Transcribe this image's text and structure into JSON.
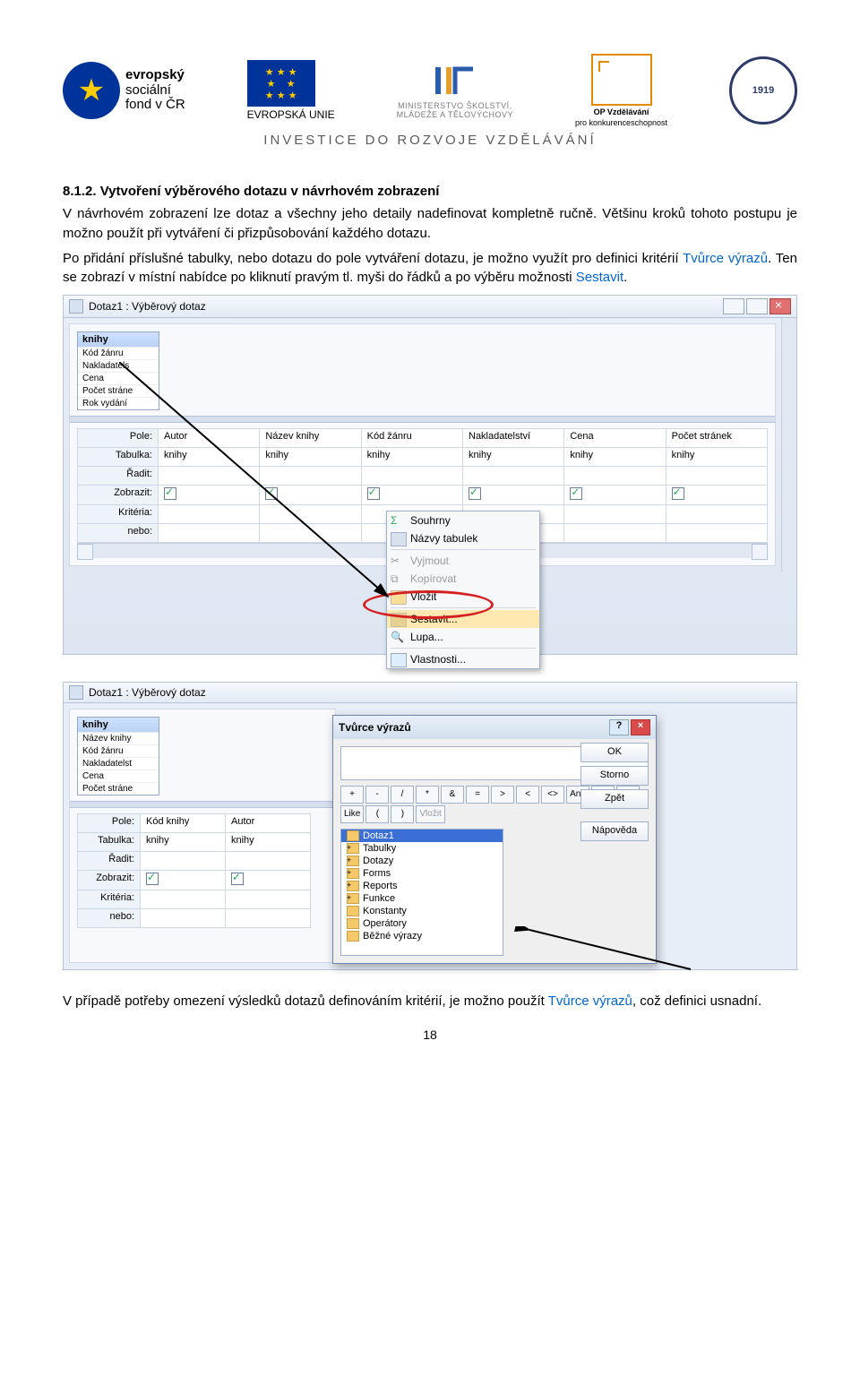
{
  "logos": {
    "esf_line1": "evropský",
    "esf_line2": "sociální",
    "esf_line3": "fond v ČR",
    "eu_label": "EVROPSKÁ UNIE",
    "msmt_line1": "MINISTERSTVO ŠKOLSTVÍ,",
    "msmt_line2": "MLÁDEŽE A TĚLOVÝCHOVY",
    "opvk_line1": "OP Vzdělávání",
    "opvk_line2": "pro konkurenceschopnost",
    "gear_year": "1919"
  },
  "invest": "INVESTICE DO ROZVOJE VZDĚLÁVÁNÍ",
  "section_heading": "8.1.2.  Vytvoření výběrového dotazu v návrhovém zobrazení",
  "para1": "V návrhovém zobrazení lze dotaz a všechny jeho detaily nadefinovat kompletně ručně. Většinu kroků tohoto postupu je možno použít při vytváření či přizpůsobování každého dotazu.",
  "para2_a": "Po přidání příslušné tabulky, nebo dotazu do pole vytváření dotazu, je možno využít pro definici kritérií ",
  "para2_link": "Tvůrce výrazů",
  "para2_b": ". Ten se zobrazí v místní nabídce po kliknutí pravým tl. myši do řádků a po výběru možnosti ",
  "para2_link2": "Sestavit",
  "para2_c": ".",
  "shot1": {
    "title": "Dotaz1 : Výběrový dotaz",
    "table_name": "knihy",
    "table_cols": [
      "Kód žánru",
      "Nakladatels",
      "Cena",
      "Počet stráne",
      "Rok vydání"
    ],
    "row_labels": [
      "Pole:",
      "Tabulka:",
      "Řadit:",
      "Zobrazit:",
      "Kritéria:",
      "nebo:"
    ],
    "cols": [
      "Autor",
      "Název knihy",
      "Kód žánru",
      "Nakladatelství",
      "Cena",
      "Počet stránek"
    ],
    "tabulka_val": "knihy",
    "menu": {
      "souhrny": "Souhrny",
      "nazvy": "Názvy tabulek",
      "vyjmout": "Vyjmout",
      "kopirovat": "Kopírovat",
      "vlozit": "Vložit",
      "sestavit": "Sestavit...",
      "lupa": "Lupa...",
      "vlastnosti": "Vlastnosti..."
    }
  },
  "shot2": {
    "title": "Dotaz1 : Výběrový dotaz",
    "table_name": "knihy",
    "table_cols": [
      "Název knihy",
      "Kód žánru",
      "Nakladatelst",
      "Cena",
      "Počet stráne"
    ],
    "row_labels": [
      "Pole:",
      "Tabulka:",
      "Řadit:",
      "Zobrazit:",
      "Kritéria:",
      "nebo:"
    ],
    "cols": [
      "Kód knihy",
      "Autor"
    ],
    "tabulka_val": "knihy",
    "dialog": {
      "title": "Tvůrce výrazů",
      "ok": "OK",
      "storno": "Storno",
      "zpet": "Zpět",
      "vlozit": "Vložit",
      "napoveda": "Nápověda",
      "ops": [
        "+",
        "-",
        "/",
        "*",
        "&",
        "=",
        ">",
        "<",
        "<>",
        "And",
        "Or",
        "Not",
        "Like",
        "(",
        ")"
      ],
      "tree": [
        "Dotaz1",
        "Tabulky",
        "Dotazy",
        "Forms",
        "Reports",
        "Funkce",
        "Konstanty",
        "Operátory",
        "Běžné výrazy"
      ]
    }
  },
  "para3_a": "V případě potřeby omezení výsledků dotazů definováním kritérií, je možno použít ",
  "para3_link": "Tvůrce výrazů",
  "para3_b": ", což definici usnadní.",
  "page_number": "18"
}
